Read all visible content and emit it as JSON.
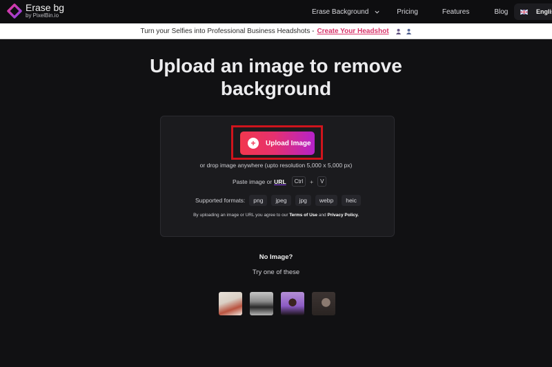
{
  "nav": {
    "logo_title": "Erase bg",
    "logo_sub": "by PixelBin.io",
    "links": [
      {
        "label": "Erase Background",
        "has_dropdown": true
      },
      {
        "label": "Pricing"
      },
      {
        "label": "Features"
      },
      {
        "label": "Blog"
      }
    ],
    "language": "English",
    "flag_icon": "uk-flag-icon"
  },
  "banner": {
    "text": "Turn your Selfies into Professional Business Headshots -",
    "link": "Create Your Headshot",
    "icons": [
      "woman-avatar-icon",
      "man-avatar-icon"
    ]
  },
  "hero": {
    "title_line1": "Upload an image to remove",
    "title_line2": "background"
  },
  "upload": {
    "button_label": "Upload Image",
    "drop_text": "or drop image anywhere (upto resolution 5,000 x 5,000 px)",
    "paste_text": "Paste image or",
    "url_label": "URL",
    "key1": "Ctrl",
    "plus": "+",
    "key2": "V",
    "formats_label": "Supported formats:",
    "formats": [
      "png",
      "jpeg",
      "jpg",
      "webp",
      "heic"
    ],
    "terms_prefix": "By uploading an image or URL you agree to our",
    "terms_link": "Terms of Use",
    "terms_and": "and",
    "privacy_link": "Privacy Policy."
  },
  "samples": {
    "heading": "No Image?",
    "subheading": "Try one of these",
    "items": [
      "sample-woman-street",
      "sample-car",
      "sample-woman-purple",
      "sample-man-portrait"
    ]
  },
  "colors": {
    "accent_start": "#f2374e",
    "accent_end": "#b522c9",
    "highlight_box": "#d0141c",
    "link_pink": "#d8336a"
  }
}
